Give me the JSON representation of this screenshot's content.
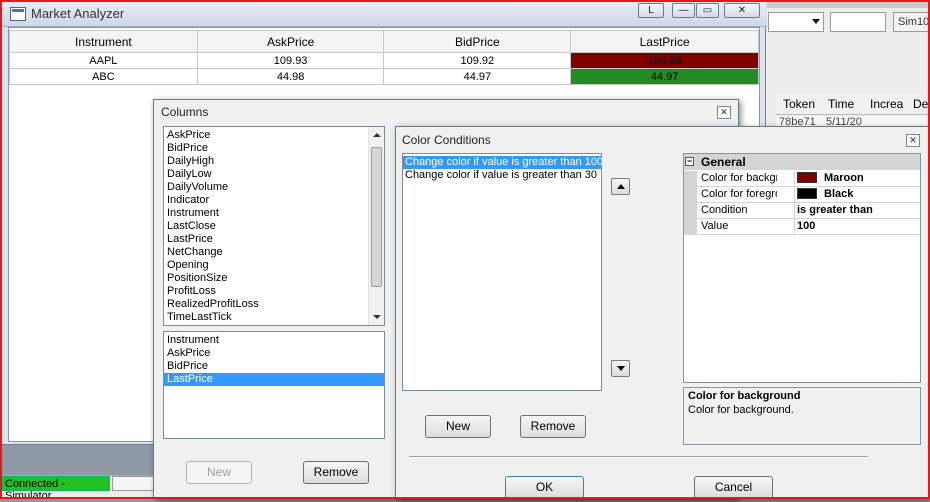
{
  "market_analyzer": {
    "title": "Market Analyzer",
    "title_buttons": {
      "l": "L",
      "minimize": "—",
      "maximize": "▭",
      "close": "✕"
    },
    "columns": [
      "Instrument",
      "AskPrice",
      "BidPrice",
      "LastPrice"
    ],
    "rows": [
      {
        "instrument": "AAPL",
        "ask": "109.93",
        "bid": "109.92",
        "last": "109.93",
        "last_color": "#800000"
      },
      {
        "instrument": "ABC",
        "ask": "44.98",
        "bid": "44.97",
        "last": "44.97",
        "last_color": "#228b22"
      }
    ]
  },
  "status_bar": {
    "connection": "Connected - Simulator"
  },
  "background_app": {
    "account_box": "Sim10",
    "grid_headers": [
      "Token",
      "Time",
      "Increa",
      "De"
    ],
    "grid_row": [
      "78be71",
      "5/11/20"
    ]
  },
  "columns_dialog": {
    "title": "Columns",
    "available": [
      "AskPrice",
      "BidPrice",
      "DailyHigh",
      "DailyLow",
      "DailyVolume",
      "Indicator",
      "Instrument",
      "LastClose",
      "LastPrice",
      "NetChange",
      "Opening",
      "PositionSize",
      "ProfitLoss",
      "RealizedProfitLoss",
      "TimeLastTick"
    ],
    "selected": [
      "Instrument",
      "AskPrice",
      "BidPrice",
      "LastPrice"
    ],
    "selected_item": "LastPrice",
    "new_label": "New",
    "remove_label": "Remove"
  },
  "color_conditions": {
    "title": "Color Conditions",
    "conditions": [
      "Change color if value is greater than 100",
      "Change color if value is greater than 30"
    ],
    "selected_condition": 0,
    "category": "General",
    "properties": [
      {
        "name": "Color for background",
        "value": "Maroon",
        "swatch": "#800000"
      },
      {
        "name": "Color for foreground",
        "value": "Black",
        "swatch": "#000000"
      },
      {
        "name": "Condition",
        "value": "is greater than"
      },
      {
        "name": "Value",
        "value": "100"
      }
    ],
    "help_title": "Color for background",
    "help_desc": "Color for background.",
    "new_label": "New",
    "remove_label": "Remove",
    "ok_label": "OK",
    "cancel_label": "Cancel",
    "close_glyph": "✕"
  }
}
